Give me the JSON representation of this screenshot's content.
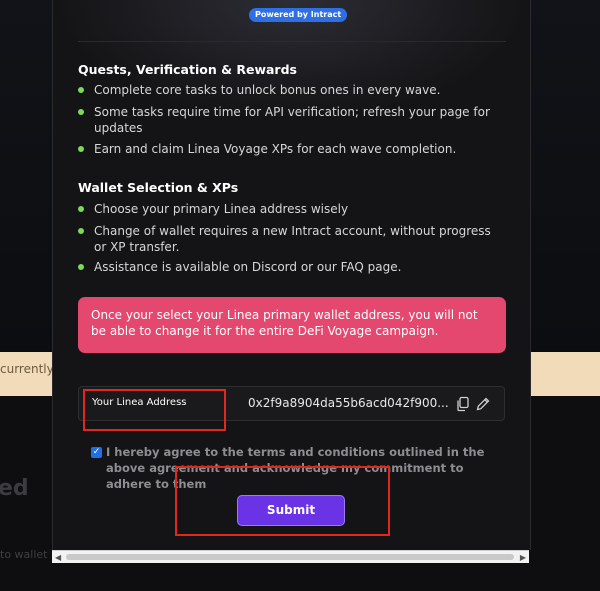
{
  "badge": {
    "powered_by": "Powered by Intract"
  },
  "sections": {
    "quests": {
      "title": "Quests, Verification & Rewards",
      "bullets": [
        "Complete core tasks to unlock bonus ones in every wave.",
        "Some tasks require time for API verification; refresh your page for updates",
        "Earn and claim Linea Voyage XPs for each wave completion."
      ]
    },
    "wallet": {
      "title": "Wallet Selection & XPs",
      "bullets": [
        "Choose your primary Linea address wisely",
        "Change of wallet requires a new Intract account, without progress or XP transfer.",
        "Assistance is available on Discord or our FAQ page."
      ]
    }
  },
  "alert": {
    "text": "Once your select your Linea primary wallet address, you will not be able to change it for the entire DeFi Voyage campaign."
  },
  "address": {
    "label": "Your Linea Address",
    "value": "0x2f9a8904da55b6acd042f900..."
  },
  "agreement": {
    "checked": true,
    "text": "I hereby agree to the terms and conditions outlined in the above agreement and acknowledge my commitment to adhere to them"
  },
  "submit": {
    "label": "Submit"
  },
  "background": {
    "band_text": "currently",
    "big_text": "ed",
    "small_text": "to wallet"
  },
  "colors": {
    "bullet": "#7ed957",
    "alert": "#e5486f",
    "submit": "#6a33e6",
    "annotation": "#e0281f",
    "badge": "#2f6fe6"
  }
}
